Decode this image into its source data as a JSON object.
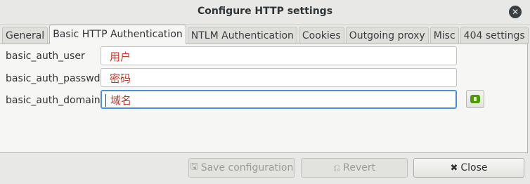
{
  "window": {
    "title": "Configure HTTP settings"
  },
  "tabs": [
    {
      "label": "General"
    },
    {
      "label": "Basic HTTP Authentication"
    },
    {
      "label": "NTLM Authentication"
    },
    {
      "label": "Cookies"
    },
    {
      "label": "Outgoing proxy"
    },
    {
      "label": "Misc"
    },
    {
      "label": "404 settings"
    }
  ],
  "active_tab": "Basic HTTP Authentication",
  "form": {
    "user": {
      "label": "basic_auth_user",
      "value": "用户"
    },
    "passwd": {
      "label": "basic_auth_passwd",
      "value": "密码"
    },
    "domain": {
      "label": "basic_auth_domain",
      "value": "域名"
    }
  },
  "buttons": {
    "save": "Save configuration",
    "revert": "Revert",
    "close": "Close"
  },
  "icons": {
    "window_close": "close-icon",
    "apply": "apply-icon",
    "save": "save-icon",
    "revert": "revert-icon",
    "close": "close-x-icon"
  },
  "colors": {
    "field_text": "#c0392b",
    "focus": "#4a90d9",
    "apply_icon": "#4e9a06"
  }
}
